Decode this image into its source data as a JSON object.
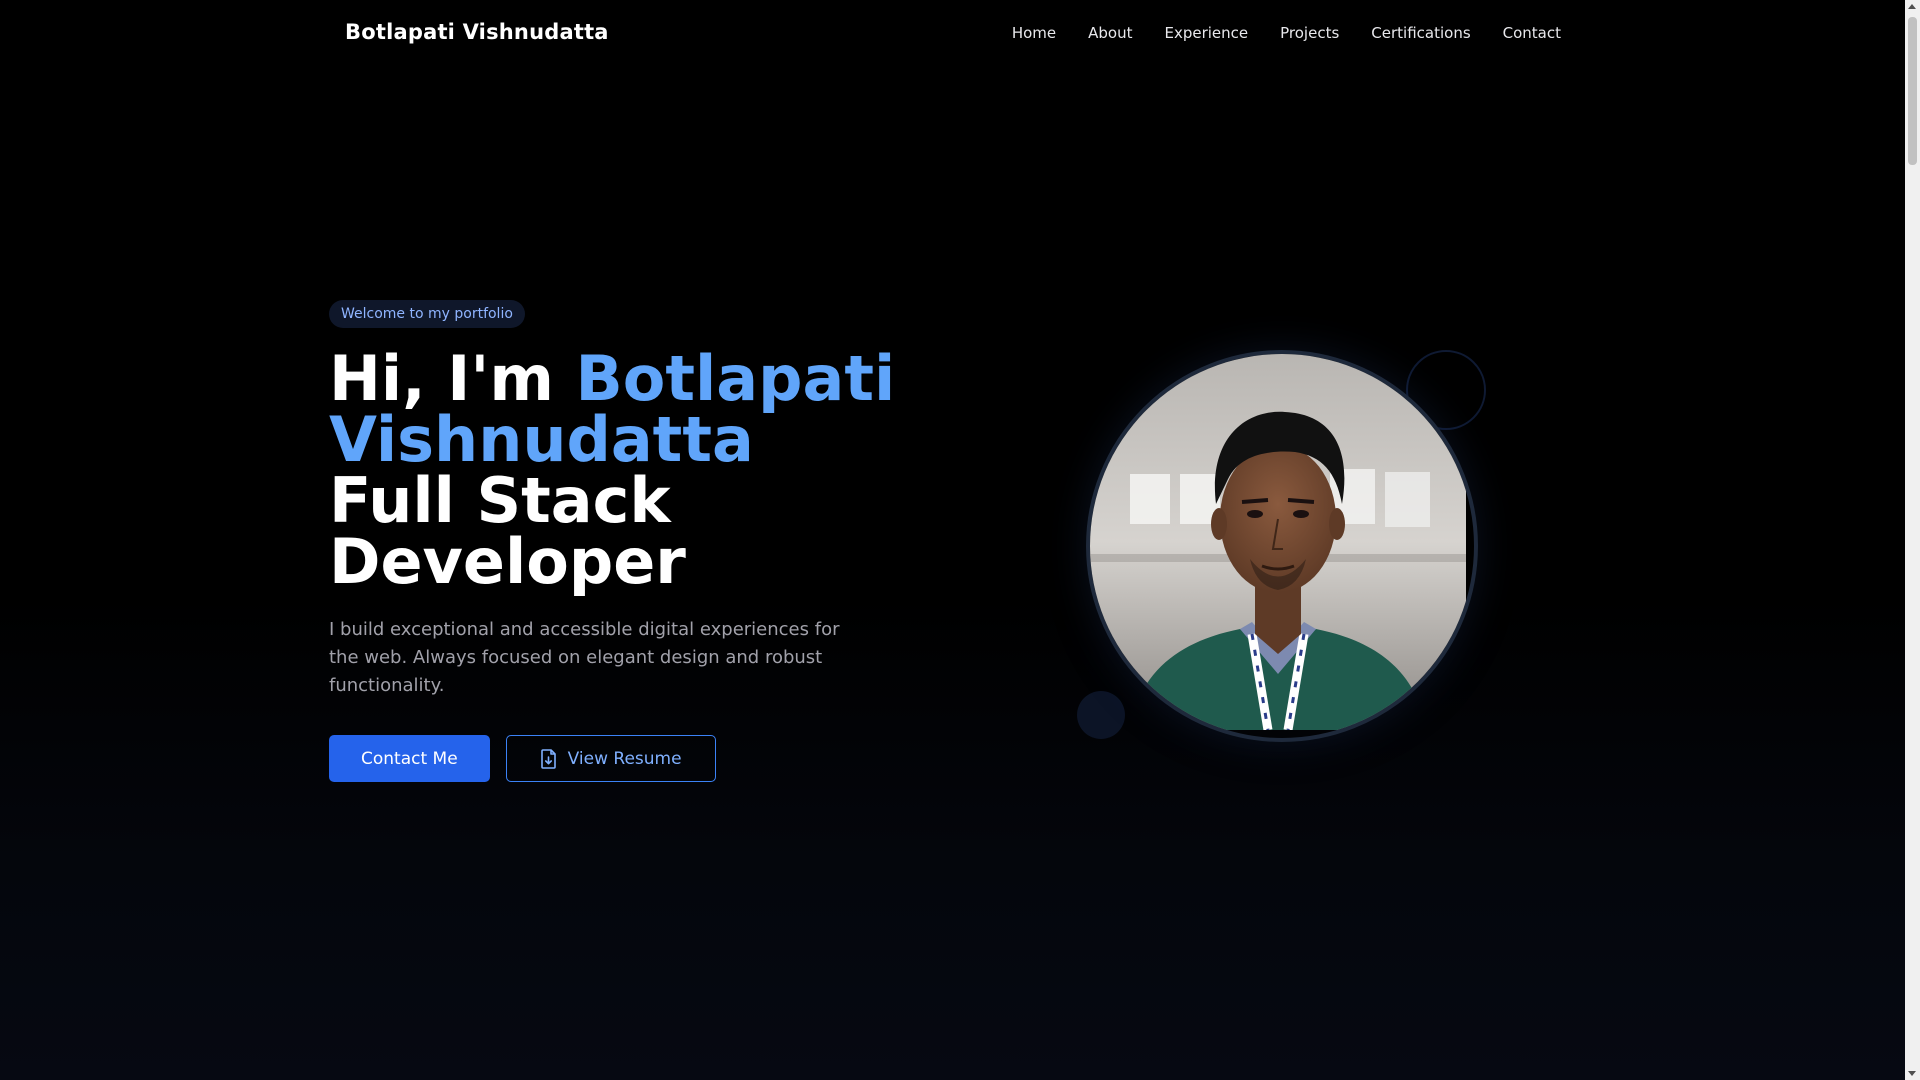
{
  "header": {
    "brand": "Botlapati Vishnudatta",
    "nav": [
      {
        "label": "Home"
      },
      {
        "label": "About"
      },
      {
        "label": "Experience"
      },
      {
        "label": "Projects"
      },
      {
        "label": "Certifications"
      },
      {
        "label": "Contact"
      }
    ]
  },
  "hero": {
    "badge": "Welcome to my portfolio",
    "greeting": "Hi, I'm ",
    "name_line1": "Botlapati",
    "name_line2": "Vishnudatta",
    "role_line1": "Full Stack",
    "role_line2": "Developer",
    "description": "I build exceptional and accessible digital experiences for the web. Always focused on elegant design and robust functionality.",
    "primary_button": "Contact Me",
    "secondary_button": "View Resume",
    "secondary_button_icon": "file-download-icon"
  },
  "colors": {
    "accent": "#60a5fa",
    "primary_button": "#2563eb",
    "background": "#000000"
  }
}
